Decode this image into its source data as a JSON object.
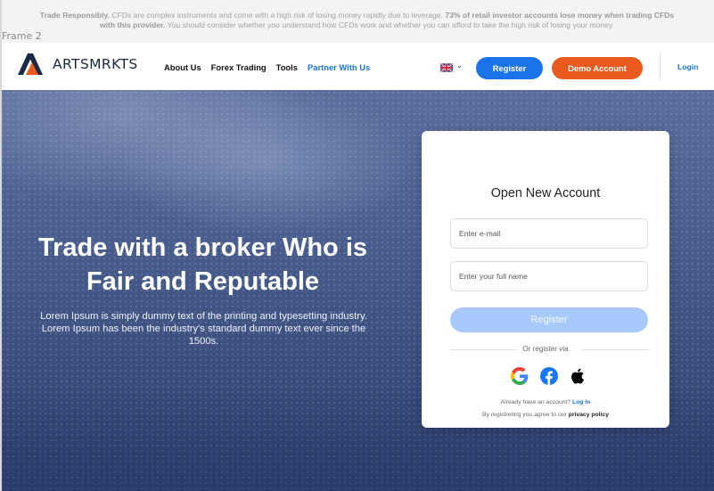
{
  "frame_label": "Frame 2",
  "warning": {
    "lead": "Trade Responsibly.",
    "text1": " CFDs are complex instruments and come with a high risk of losing money rapidly due to leverage. ",
    "highlight": "73% of retail investor accounts lose money when trading CFDs with this provider.",
    "text2": " You should consider whether you understand how CFDs work and whether you can afford to take the high risk of losing your money."
  },
  "brand": {
    "name": "ARTSMRKTS",
    "accent": "#ea5a1f",
    "primary": "#1a73e8",
    "logo_icon": "artsmrkts-logo-icon"
  },
  "nav": {
    "links": [
      "About Us",
      "Forex Trading",
      "Tools",
      "Partner With Us"
    ],
    "language_flag": "uk-flag-icon",
    "register_label": "Register",
    "demo_label": "Demo Account",
    "login_label": "Login"
  },
  "hero": {
    "title": "Trade with a broker Who is Fair and Reputable",
    "subtitle": "Lorem Ipsum is simply dummy text of the printing and typesetting industry. Lorem Ipsum has been the industry's standard dummy text ever since the 1500s."
  },
  "signup": {
    "title": "Open New Account",
    "email_placeholder": "Enter e-mail",
    "name_placeholder": "Enter your full name",
    "register_label": "Register",
    "or_text": "Or register via",
    "social": [
      "google-icon",
      "facebook-icon",
      "apple-icon"
    ],
    "have_account_text": "Already have an account?",
    "login_link": "Log In",
    "agree_text": "By registreting you agree to our",
    "privacy_link": "privacy policy"
  }
}
